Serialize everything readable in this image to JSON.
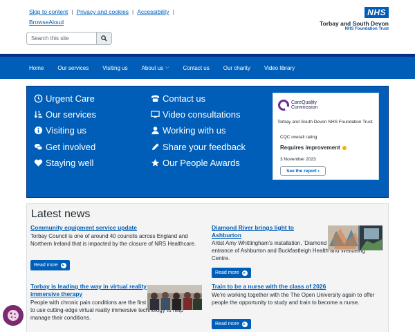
{
  "header": {
    "skip_links": [
      "Skip to content",
      "Privacy and cookies",
      "Accessibility",
      "BrowseAloud"
    ],
    "search_placeholder": "Search this site",
    "logo_mark": "NHS",
    "trust_name": "Torbay and South Devon",
    "trust_sub": "NHS Foundation Trust"
  },
  "nav": {
    "items": [
      "Home",
      "Our services",
      "Visiting us",
      "About us",
      "Contact us",
      "Our charity",
      "Video library"
    ]
  },
  "quick_links": {
    "left": [
      {
        "label": "Urgent Care",
        "icon": "clock-icon"
      },
      {
        "label": "Our services",
        "icon": "sort-icon"
      },
      {
        "label": "Visiting us",
        "icon": "info-icon"
      },
      {
        "label": "Get involved",
        "icon": "chat-icon"
      },
      {
        "label": "Staying well",
        "icon": "heart-icon"
      }
    ],
    "right": [
      {
        "label": "Contact us",
        "icon": "phone-icon"
      },
      {
        "label": "Video consultations",
        "icon": "monitor-icon"
      },
      {
        "label": "Working with us",
        "icon": "user-icon"
      },
      {
        "label": "Share your feedback",
        "icon": "pencil-icon"
      },
      {
        "label": "Our People Awards",
        "icon": "star-icon"
      }
    ]
  },
  "cqc": {
    "logo_line1": "CareQuality",
    "logo_line2": "Commission",
    "org": "Torbay and South Devon NHS Foundation Trust",
    "label": "CQC overall rating",
    "rating": "Requires improvement",
    "date": "3 November 2023",
    "report_button": "See the report",
    "rating_color": "#f0b400"
  },
  "news": {
    "heading": "Latest news",
    "read_more": "Read more",
    "articles": [
      {
        "title": "Community equipment service update",
        "text": "Torbay Council is one of around 40 councils across England and Northern Ireland that is impacted by the closure of NRS Healthcare."
      },
      {
        "title": "Diamond River brings light to Ashburton",
        "text": "Artist Amy Whittingham's installation, 'Diamond River', adorns the entrance of Ashburton and Buckfastleigh Health and Wellbeing Centre."
      },
      {
        "title": "Torbay is leading the way in virtual reality immersive therapy",
        "text": "People with chronic pain conditions are the first in the country to use cutting-edge virtual reality immersive technology to help manage their conditions."
      },
      {
        "title": "Train to be a nurse with the class of 2026",
        "text": "We're working together with the The Open University again to offer people the opportunity to study and train to become a nurse."
      }
    ]
  },
  "colors": {
    "brand_blue": "#005eb8",
    "dark_blue": "#003087",
    "cookie_purple": "#7a2a6e"
  }
}
